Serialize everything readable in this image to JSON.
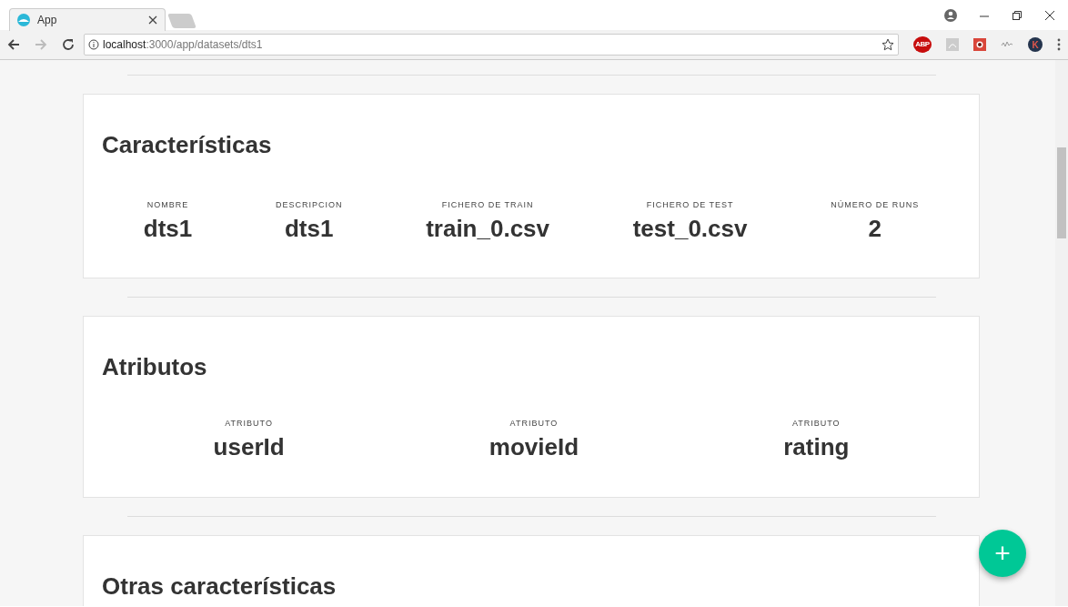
{
  "browser": {
    "tab": {
      "title": "App"
    },
    "address": {
      "host": "localhost",
      "path": ":3000/app/datasets/dts1"
    },
    "extensions": [
      {
        "kind": "abp",
        "label": "ABP"
      },
      {
        "kind": "pdf"
      },
      {
        "kind": "puzzle"
      },
      {
        "kind": "wave"
      },
      {
        "kind": "avatar",
        "label": "K"
      }
    ]
  },
  "sections": [
    {
      "title": "Características",
      "kind": "stats",
      "items": [
        {
          "label": "NOMBRE",
          "value": "dts1"
        },
        {
          "label": "DESCRIPCION",
          "value": "dts1"
        },
        {
          "label": "FICHERO DE TRAIN",
          "value": "train_0.csv"
        },
        {
          "label": "FICHERO DE TEST",
          "value": "test_0.csv"
        },
        {
          "label": "NÚMERO DE RUNS",
          "value": "2"
        }
      ]
    },
    {
      "title": "Atributos",
      "kind": "attributes",
      "items": [
        {
          "label": "ATRIBUTO",
          "value": "userId"
        },
        {
          "label": "ATRIBUTO",
          "value": "movieId"
        },
        {
          "label": "ATRIBUTO",
          "value": "rating"
        }
      ]
    },
    {
      "title": "Otras características"
    }
  ],
  "fab": {
    "label": "+"
  }
}
